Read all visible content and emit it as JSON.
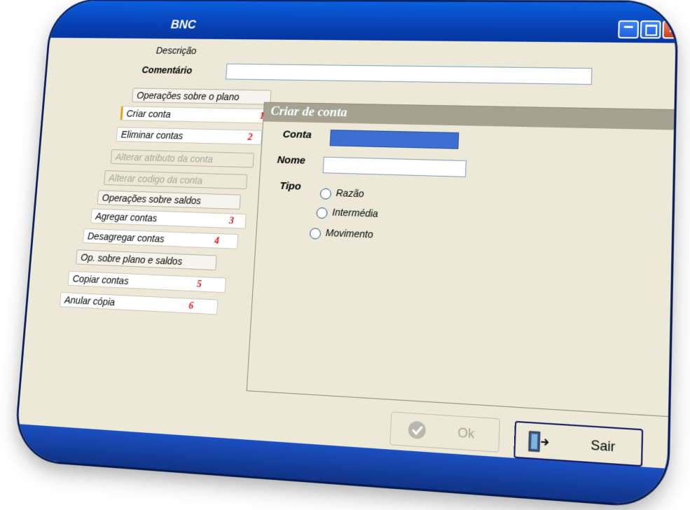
{
  "window": {
    "title": "BNC"
  },
  "form": {
    "descricao_label": "Descrição",
    "comentario_label": "Comentário",
    "comentario_value": ""
  },
  "menu": {
    "items": [
      {
        "label": "Operações sobre o plano",
        "kind": "header",
        "number": ""
      },
      {
        "label": "Criar conta",
        "kind": "active",
        "number": "1"
      },
      {
        "label": "Eliminar contas",
        "kind": "item",
        "number": "2"
      },
      {
        "label": "Alterar atributo da conta",
        "kind": "disabled",
        "number": ""
      },
      {
        "label": "Alterar codigo da conta",
        "kind": "disabled",
        "number": ""
      },
      {
        "label": "Operações sobre saldos",
        "kind": "header",
        "number": ""
      },
      {
        "label": "Agregar contas",
        "kind": "item",
        "number": "3"
      },
      {
        "label": "Desagregar contas",
        "kind": "item",
        "number": "4"
      },
      {
        "label": "Op. sobre plano e saldos",
        "kind": "header",
        "number": ""
      },
      {
        "label": "Copiar contas",
        "kind": "item",
        "number": "5"
      },
      {
        "label": "Anular cópia",
        "kind": "item",
        "number": "6"
      }
    ]
  },
  "panel": {
    "title": "Criar de conta",
    "conta_label": "Conta",
    "conta_value": "",
    "nome_label": "Nome",
    "nome_value": "",
    "tipo_label": "Tipo",
    "tipo_options": [
      "Razão",
      "Intermédia",
      "Movimento"
    ],
    "tipo_selected": ""
  },
  "buttons": {
    "ok_label": "Ok",
    "sair_label": "Sair"
  },
  "colors": {
    "titlebar": "#0842b5",
    "window_bg": "#ece9d8",
    "panel_header": "#a6a292",
    "conta_field": "#3c6fd0",
    "step_numbers": "#e01010"
  }
}
